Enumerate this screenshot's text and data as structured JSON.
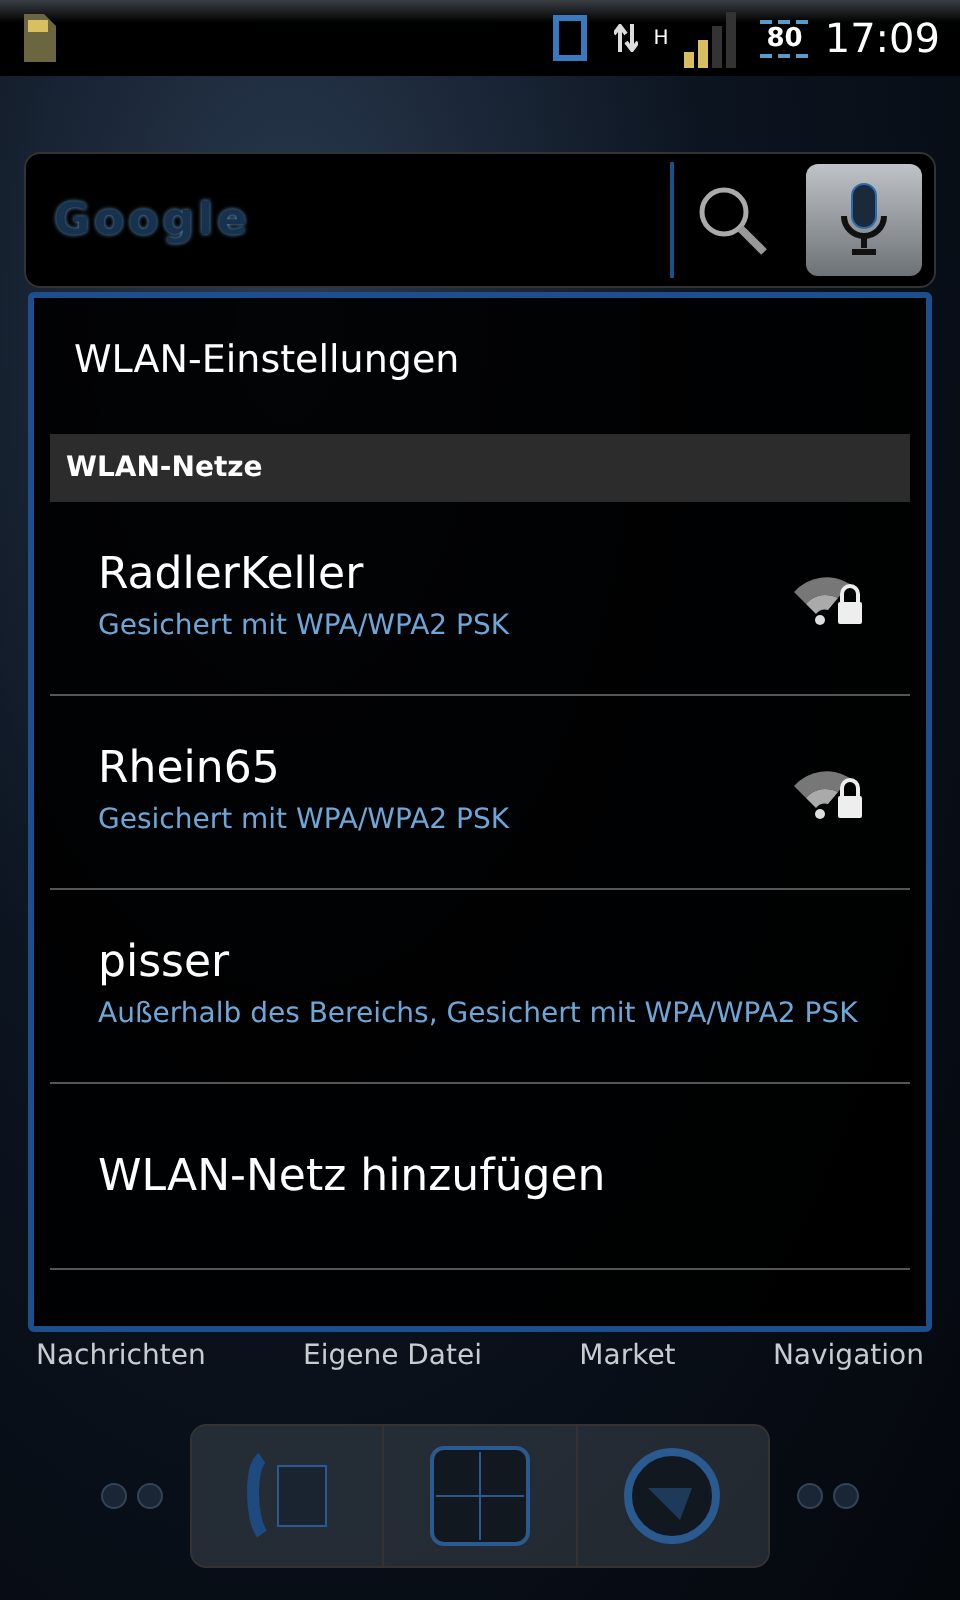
{
  "status_bar": {
    "network_type": "H",
    "battery": "80",
    "time": "17:09"
  },
  "search_widget": {
    "logo": "Google"
  },
  "dialog": {
    "title": "WLAN-Einstellungen",
    "section": "WLAN-Netze",
    "networks": [
      {
        "name": "RadlerKeller",
        "status": "Gesichert mit WPA/WPA2 PSK",
        "in_range": true
      },
      {
        "name": "Rhein65",
        "status": "Gesichert mit WPA/WPA2 PSK",
        "in_range": true
      },
      {
        "name": "pisser",
        "status": "Außerhalb des Bereichs, Gesichert mit WPA/WPA2 PSK",
        "in_range": false
      }
    ],
    "add_network": "WLAN-Netz hinzufügen"
  },
  "home_labels": [
    "Nachrichten",
    "Eigene Datei",
    "Market",
    "Navigation"
  ]
}
